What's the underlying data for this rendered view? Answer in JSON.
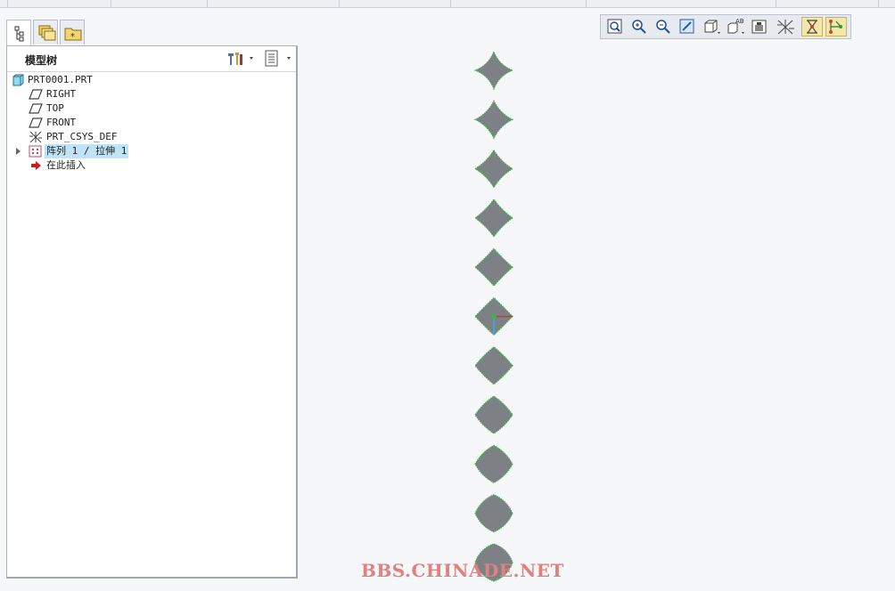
{
  "left_panel": {
    "tree_title": "模型树",
    "tabs": [
      "model-tree-tab",
      "folder-browser-tab",
      "favorites-tab"
    ],
    "items": [
      {
        "label": "PRT0001.PRT",
        "icon": "part-icon"
      },
      {
        "label": "RIGHT",
        "icon": "datum-plane-icon"
      },
      {
        "label": "TOP",
        "icon": "datum-plane-icon"
      },
      {
        "label": "FRONT",
        "icon": "datum-plane-icon"
      },
      {
        "label": "PRT_CSYS_DEF",
        "icon": "coordinate-system-icon"
      },
      {
        "label": "阵列 1 / 拉伸 1",
        "icon": "pattern-icon",
        "selected": true,
        "expandable": true
      },
      {
        "label": "在此插入",
        "icon": "insert-here-arrow-icon"
      }
    ]
  },
  "toolbar": {
    "buttons": [
      "refit-icon",
      "zoom-in-icon",
      "zoom-out-icon",
      "repaint-icon",
      "display-style-icon",
      "saved-views-icon",
      "view-manager-icon",
      "datum-display-icon",
      "spin-center-icon",
      "annotation-display-icon"
    ],
    "active": [
      "spin-center-icon",
      "annotation-display-icon"
    ]
  },
  "viewport": {
    "pattern_instances": 11,
    "shape_fill": "#7d8186",
    "edge_color": "#46b34b"
  },
  "watermark": "BBS.CHINADE.NET"
}
